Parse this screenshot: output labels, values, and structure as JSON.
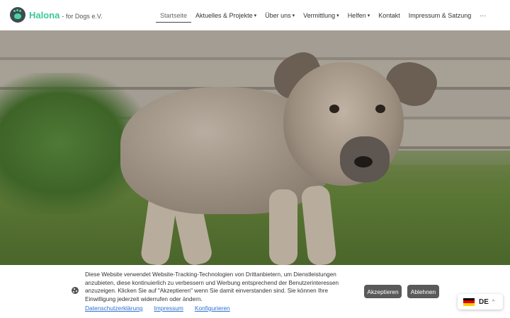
{
  "logo": {
    "name": "Halona",
    "sub": "- for Dogs e.V."
  },
  "nav": {
    "items": [
      {
        "label": "Startseite",
        "caret": ""
      },
      {
        "label": "Aktuelles & Projekte",
        "caret": "▾"
      },
      {
        "label": "Über uns",
        "caret": "▾"
      },
      {
        "label": "Vermittlung",
        "caret": "▾"
      },
      {
        "label": "Helfen",
        "caret": "▾"
      },
      {
        "label": "Kontakt",
        "caret": ""
      },
      {
        "label": "Impressum & Satzung",
        "caret": ""
      },
      {
        "label": "···",
        "caret": ""
      }
    ]
  },
  "cookie": {
    "text": "Diese Website verwendet Website-Tracking-Technologien von Drittanbietern, um Dienstleistungen anzubieten, diese kontinuierlich zu verbessern und Werbung entsprechend der Benutzerinteressen anzuzeigen. Klicken Sie auf \"Akzeptieren\" wenn Sie damit einverstanden sind. Sie können Ihre Einwilligung jederzeit widerrufen oder ändern.",
    "links": [
      "Datenschutzerklärung",
      "Impressum",
      "Konfigurieren"
    ],
    "accept": "Akzeptieren",
    "decline": "Ablehnen"
  },
  "language": {
    "code": "DE",
    "caret": "^"
  },
  "colors": {
    "brand": "#3ec79a",
    "button": "#5a5a5a",
    "link": "#2f6fd0"
  },
  "icons": {
    "logo": "paw-logo-icon",
    "cookie": "cookie-icon",
    "flag": "germany-flag-icon"
  }
}
